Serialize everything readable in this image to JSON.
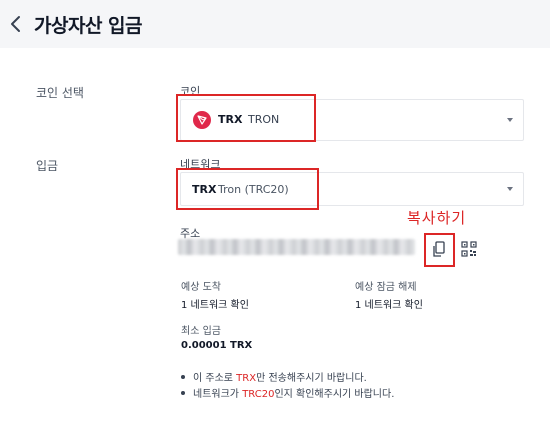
{
  "header": {
    "title": "가상자산 입금"
  },
  "coin_section": {
    "label": "코인 선택",
    "field_label": "코인",
    "selected_ticker": "TRX",
    "selected_name": "TRON"
  },
  "deposit_section": {
    "label": "입금",
    "network_label": "네트워크",
    "network_ticker": "TRX",
    "network_name": "Tron (TRC20)",
    "address_label": "주소",
    "annotation": "복사하기"
  },
  "info": {
    "expected_arrival_label": "예상 도착",
    "expected_arrival_value": "1 네트워크 확인",
    "expected_unlock_label": "예상 잠금 해제",
    "expected_unlock_value": "1 네트워크 확인",
    "min_deposit_label": "최소 입금",
    "min_deposit_value": "0.00001 TRX"
  },
  "notes": [
    {
      "prefix": "이 주소로 ",
      "highlight": "TRX",
      "suffix": "만 전송해주시기 바랍니다."
    },
    {
      "prefix": "네트워크가 ",
      "highlight": "TRC20",
      "suffix": "인지 확인해주시기 바랍니다."
    }
  ],
  "colors": {
    "accent_red": "#dc2626",
    "tron_red": "#e0284a",
    "header_bg": "#f5f6f8"
  },
  "icons": [
    "chevron-left-icon",
    "tron-logo-icon",
    "caret-down-icon",
    "copy-icon",
    "qr-code-icon"
  ]
}
